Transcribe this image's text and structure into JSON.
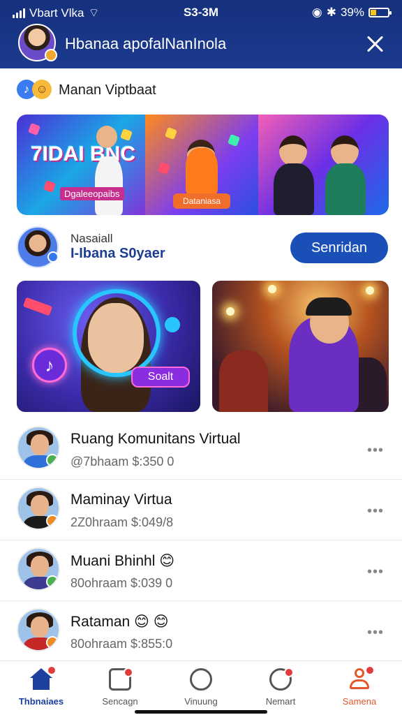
{
  "status_bar": {
    "carrier": "Vbart Vlka",
    "time": "S3-3M",
    "battery": "39%"
  },
  "header": {
    "title": "Hbanaa apofalNanInola"
  },
  "section": {
    "title": "Manan Viptbaat"
  },
  "banner": {
    "big_text": "7IDAI BNC",
    "label": "Dgaleeopaibs",
    "button": "Dataniasa"
  },
  "profile": {
    "subtitle": "Nasaiall",
    "name": "I-Ibana S0yaer",
    "button": "Senridan"
  },
  "cards": {
    "sound_pill": "Soalt"
  },
  "list": [
    {
      "name": "Ruang Komunitans Virtual",
      "meta": "@7bhaam  $:350 0",
      "dot_color": "#4caf50",
      "body_color": "#2f6fd8"
    },
    {
      "name": "Maminay Virtua",
      "meta": "2Z0hraam  $:049/8",
      "dot_color": "#f08a24",
      "body_color": "#1b1b1b"
    },
    {
      "name": "Muani Bhinhl 😊",
      "meta": "80ohraam  $:039 0",
      "dot_color": "#4caf50",
      "body_color": "#3b3b8f"
    },
    {
      "name": "Rataman 😊 😊",
      "meta": "80ohraam  $:855:0",
      "dot_color": "#f08a24",
      "body_color": "#c62828"
    }
  ],
  "nav": [
    {
      "label": "Thbnaiaes",
      "color": "#1d3f9e",
      "icon": "home-icon"
    },
    {
      "label": "Sencagn",
      "color": "#555555",
      "icon": "chat-icon"
    },
    {
      "label": "Vinuung",
      "color": "#555555",
      "icon": "emoji-icon"
    },
    {
      "label": "Nemart",
      "color": "#555555",
      "icon": "notification-icon"
    },
    {
      "label": "Samena",
      "color": "#e2572b",
      "icon": "profile-icon"
    }
  ],
  "colors": {
    "header_bg": "#1b3a8f",
    "accent": "#1b4fb8"
  }
}
